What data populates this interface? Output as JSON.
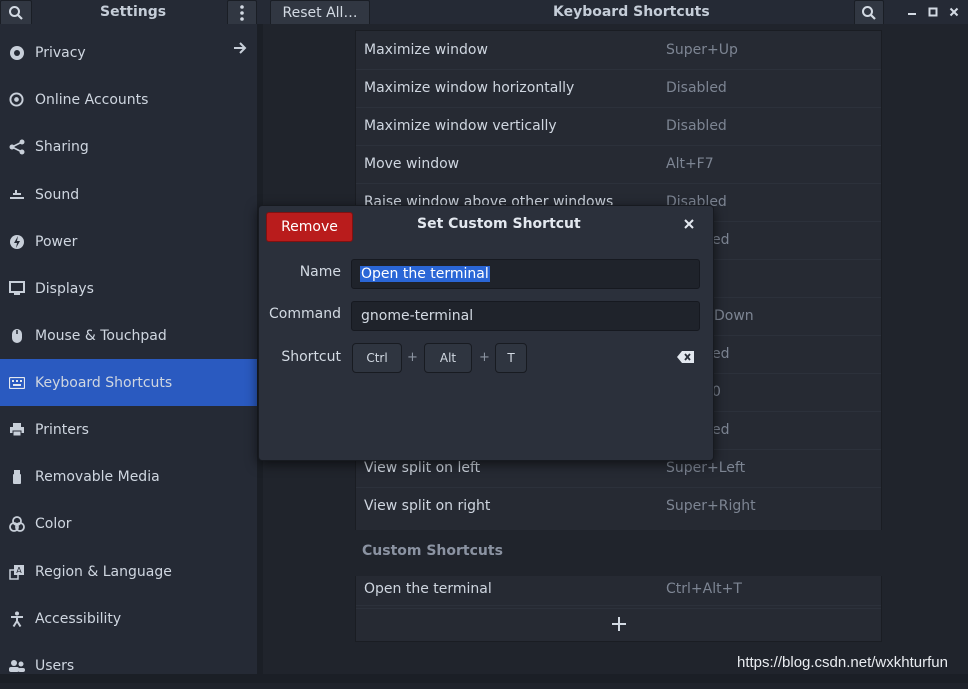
{
  "header": {
    "sidebar_title": "Settings",
    "reset_label": "Reset All…",
    "panel_title": "Keyboard Shortcuts",
    "icons": [
      "search-icon",
      "kebab-menu-icon",
      "search-icon",
      "minimize-icon",
      "maximize-icon",
      "close-icon"
    ]
  },
  "sidebar": {
    "items": [
      {
        "label": "Privacy",
        "icon": "privacy-icon",
        "has_arrow": true
      },
      {
        "label": "Online Accounts",
        "icon": "at-icon"
      },
      {
        "label": "Sharing",
        "icon": "share-icon"
      },
      {
        "label": "Sound",
        "icon": "sound-icon"
      },
      {
        "label": "Power",
        "icon": "power-icon"
      },
      {
        "label": "Displays",
        "icon": "display-icon"
      },
      {
        "label": "Mouse & Touchpad",
        "icon": "mouse-icon"
      },
      {
        "label": "Keyboard Shortcuts",
        "icon": "keyboard-icon",
        "selected": true
      },
      {
        "label": "Printers",
        "icon": "printer-icon"
      },
      {
        "label": "Removable Media",
        "icon": "usb-icon"
      },
      {
        "label": "Color",
        "icon": "color-icon"
      },
      {
        "label": "Region & Language",
        "icon": "region-icon"
      },
      {
        "label": "Accessibility",
        "icon": "accessibility-icon"
      },
      {
        "label": "Users",
        "icon": "users-icon"
      }
    ]
  },
  "shortcuts": {
    "rows": [
      {
        "name": "Maximize window",
        "shortcut": "Super+Up"
      },
      {
        "name": "Maximize window horizontally",
        "shortcut": "Disabled"
      },
      {
        "name": "Maximize window vertically",
        "shortcut": "Disabled"
      },
      {
        "name": "Move window",
        "shortcut": "Alt+F7"
      },
      {
        "name": "Raise window above other windows",
        "shortcut": "Disabled"
      },
      {
        "name": "",
        "shortcut": "ed"
      },
      {
        "name": "",
        "shortcut": ""
      },
      {
        "name": "",
        "shortcut": "Down"
      },
      {
        "name": "",
        "shortcut": "ed"
      },
      {
        "name": "",
        "shortcut": "0"
      },
      {
        "name": "",
        "shortcut": "ed"
      },
      {
        "name": "View split on left",
        "shortcut": "Super+Left"
      },
      {
        "name": "View split on right",
        "shortcut": "Super+Right"
      }
    ],
    "custom_section": "Custom Shortcuts",
    "custom_rows": [
      {
        "name": "Open the terminal",
        "shortcut": "Ctrl+Alt+T"
      }
    ],
    "add_icon": "plus-icon"
  },
  "dialog": {
    "title": "Set Custom Shortcut",
    "remove_label": "Remove",
    "name_label": "Name",
    "name_value": "Open the terminal",
    "command_label": "Command",
    "command_value": "gnome-terminal",
    "shortcut_label": "Shortcut",
    "keys": [
      "Ctrl",
      "Alt",
      "T"
    ],
    "plus": "+",
    "close_icon": "close-icon",
    "clear_icon": "backspace-icon"
  },
  "watermark": "https://blog.csdn.net/wxkhturfun",
  "colors": {
    "accent": "#2a5ac0",
    "danger": "#b91c1c",
    "selection": "#2a66d6"
  }
}
